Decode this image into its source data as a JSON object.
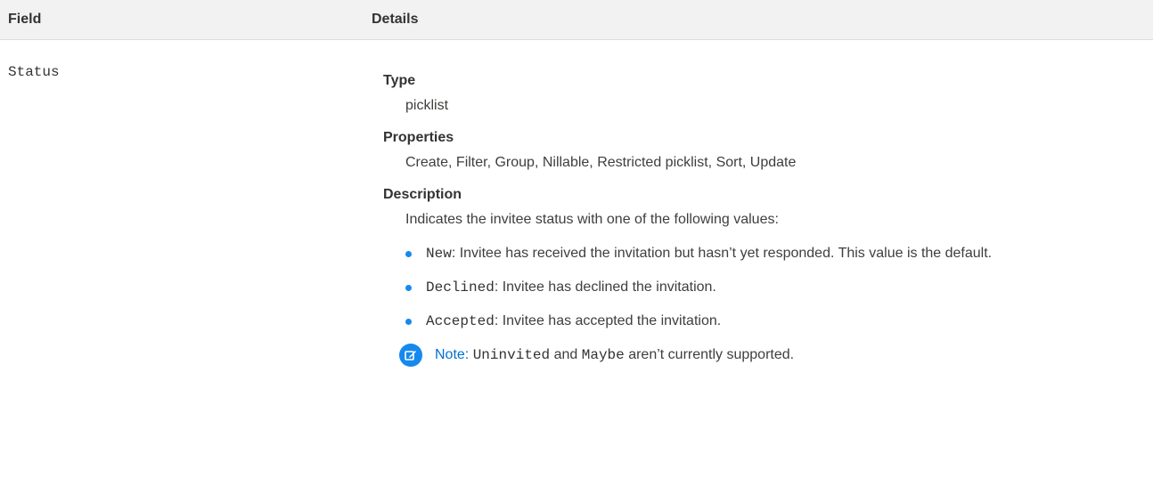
{
  "table": {
    "headers": {
      "field": "Field",
      "details": "Details"
    },
    "row": {
      "field_name": "Status",
      "type_label": "Type",
      "type_value": "picklist",
      "properties_label": "Properties",
      "properties_value": "Create, Filter, Group, Nillable, Restricted picklist, Sort, Update",
      "description_label": "Description",
      "description_intro": "Indicates the invitee status with one of the following values:",
      "values": [
        {
          "code": "New",
          "text": ": Invitee has received the invitation but hasn’t yet responded. This value is the default."
        },
        {
          "code": "Declined",
          "text": ": Invitee has declined the invitation."
        },
        {
          "code": "Accepted",
          "text": ": Invitee has accepted the invitation."
        }
      ],
      "note": {
        "label": "Note:",
        "code1": "Uninvited",
        "and": "and",
        "code2": "Maybe",
        "rest": "aren’t currently supported."
      }
    }
  },
  "icons": {
    "note": "edit-note-icon"
  },
  "colors": {
    "header_bg": "#f3f2f2",
    "bullet": "#1589ee",
    "note_label": "#0070d2",
    "note_icon_bg": "#1589ee"
  }
}
